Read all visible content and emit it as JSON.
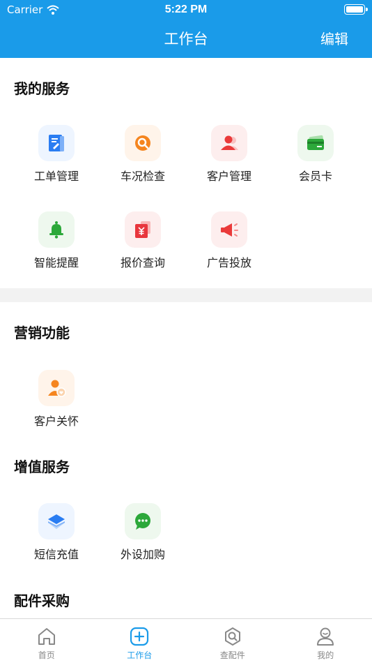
{
  "status_bar": {
    "carrier": "Carrier",
    "time": "5:22 PM"
  },
  "header": {
    "title": "工作台",
    "edit_label": "编辑"
  },
  "sections": {
    "my_services": {
      "title": "我的服务",
      "items": [
        {
          "label": "工单管理",
          "icon": "work-order-icon"
        },
        {
          "label": "车况检查",
          "icon": "car-check-icon"
        },
        {
          "label": "客户管理",
          "icon": "customer-icon"
        },
        {
          "label": "会员卡",
          "icon": "member-card-icon"
        },
        {
          "label": "智能提醒",
          "icon": "bell-icon"
        },
        {
          "label": "报价查询",
          "icon": "quote-icon"
        },
        {
          "label": "广告投放",
          "icon": "megaphone-icon"
        }
      ]
    },
    "marketing": {
      "title": "营销功能",
      "items": [
        {
          "label": "客户关怀",
          "icon": "customer-care-icon"
        }
      ]
    },
    "value_added": {
      "title": "增值服务",
      "items": [
        {
          "label": "短信充值",
          "icon": "sms-recharge-icon"
        },
        {
          "label": "外设加购",
          "icon": "chat-icon"
        }
      ]
    },
    "parts": {
      "title": "配件采购"
    }
  },
  "tabbar": {
    "items": [
      {
        "label": "首页",
        "icon": "home-icon"
      },
      {
        "label": "工作台",
        "icon": "plus-square-icon"
      },
      {
        "label": "查配件",
        "icon": "parts-search-icon"
      },
      {
        "label": "我的",
        "icon": "profile-icon"
      }
    ],
    "active_index": 1
  },
  "colors": {
    "primary": "#1a9be9",
    "band": "#f2f2f2"
  }
}
